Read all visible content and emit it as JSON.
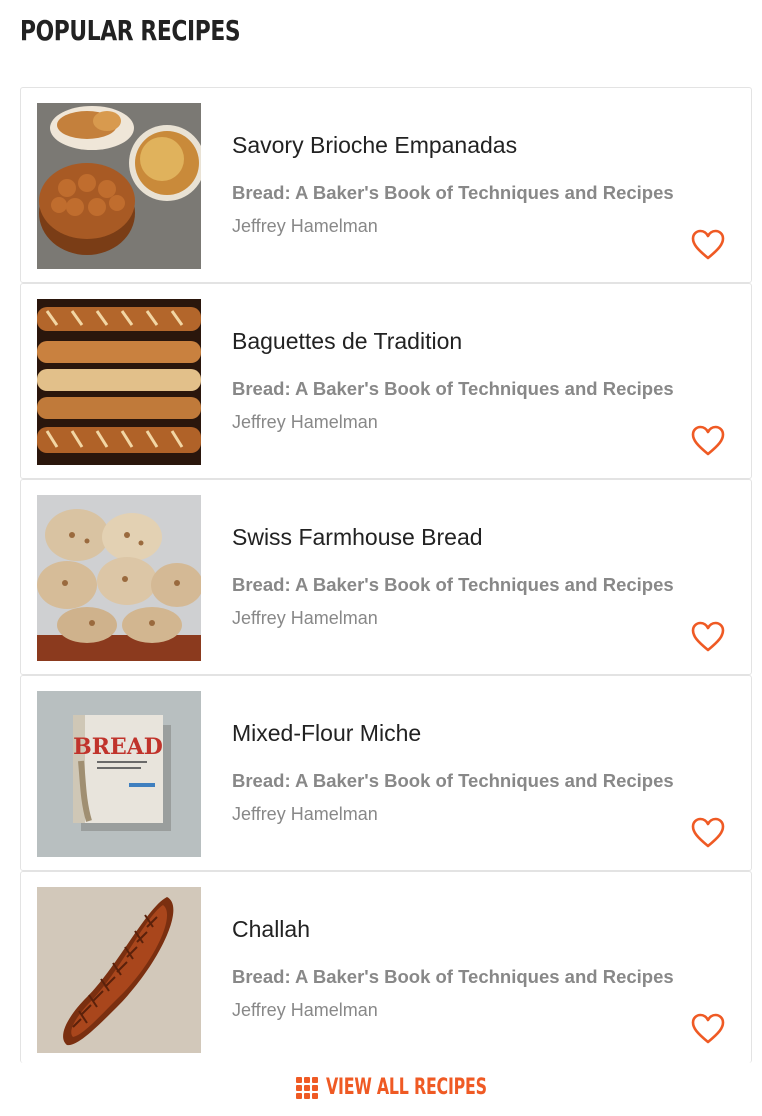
{
  "header": {
    "title": "POPULAR RECIPES"
  },
  "accent_color": "#ef5a24",
  "recipes": [
    {
      "title": "Savory Brioche Empanadas",
      "book": "Bread: A Baker's Book of Techniques and Recipes",
      "author": "Jeffrey Hamelman",
      "image": "brioche-empanadas-photo",
      "favorite_icon": "heart-outline-icon"
    },
    {
      "title": "Baguettes de Tradition",
      "book": "Bread: A Baker's Book of Techniques and Recipes",
      "author": "Jeffrey Hamelman",
      "image": "baguettes-photo",
      "favorite_icon": "heart-outline-icon"
    },
    {
      "title": "Swiss Farmhouse Bread",
      "book": "Bread: A Baker's Book of Techniques and Recipes",
      "author": "Jeffrey Hamelman",
      "image": "farmhouse-bread-photo",
      "favorite_icon": "heart-outline-icon"
    },
    {
      "title": "Mixed-Flour Miche",
      "book": "Bread: A Baker's Book of Techniques and Recipes",
      "author": "Jeffrey Hamelman",
      "image": "book-cover-photo",
      "favorite_icon": "heart-outline-icon"
    },
    {
      "title": "Challah",
      "book": "Bread: A Baker's Book of Techniques and Recipes",
      "author": "Jeffrey Hamelman",
      "image": "challah-photo",
      "favorite_icon": "heart-outline-icon"
    }
  ],
  "footer": {
    "view_all_label": "VIEW ALL RECIPES",
    "view_all_icon": "grid-icon"
  }
}
